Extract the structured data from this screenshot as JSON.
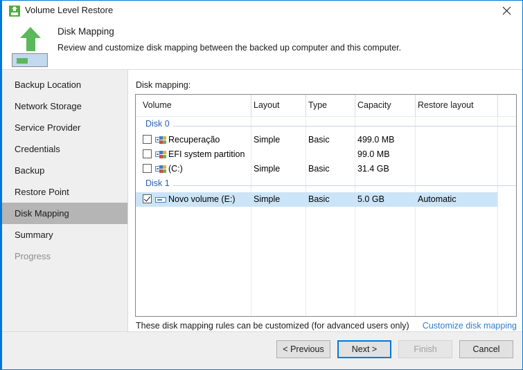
{
  "window": {
    "title": "Volume Level Restore",
    "close_label": "Close",
    "icon": "restore-upload-icon"
  },
  "header": {
    "title": "Disk Mapping",
    "subtitle": "Review and customize disk mapping between the backed up computer and this computer.",
    "icon": "green-up-arrow-volume-icon"
  },
  "sidebar": {
    "items": [
      {
        "label": "Backup Location",
        "state": "normal"
      },
      {
        "label": "Network Storage",
        "state": "normal"
      },
      {
        "label": "Service Provider",
        "state": "normal"
      },
      {
        "label": "Credentials",
        "state": "normal"
      },
      {
        "label": "Backup",
        "state": "normal"
      },
      {
        "label": "Restore Point",
        "state": "normal"
      },
      {
        "label": "Disk Mapping",
        "state": "selected"
      },
      {
        "label": "Summary",
        "state": "normal"
      },
      {
        "label": "Progress",
        "state": "disabled"
      }
    ]
  },
  "main": {
    "grid_label": "Disk mapping:",
    "columns": [
      "Volume",
      "Layout",
      "Type",
      "Capacity",
      "Restore layout"
    ],
    "groups": [
      {
        "label": "Disk 0",
        "rows": [
          {
            "checked": false,
            "icon": "partition-icon",
            "volume": "Recuperação",
            "layout": "Simple",
            "type": "Basic",
            "capacity": "499.0 MB",
            "restore_layout": "",
            "selected": false
          },
          {
            "checked": false,
            "icon": "partition-icon",
            "volume": "EFI system partition",
            "layout": "",
            "type": "",
            "capacity": "99.0 MB",
            "restore_layout": "",
            "selected": false
          },
          {
            "checked": false,
            "icon": "partition-icon",
            "volume": "(C:)",
            "layout": "Simple",
            "type": "Basic",
            "capacity": "31.4 GB",
            "restore_layout": "",
            "selected": false
          }
        ]
      },
      {
        "label": "Disk 1",
        "rows": [
          {
            "checked": true,
            "icon": "drive-icon",
            "volume": "Novo volume (E:)",
            "layout": "Simple",
            "type": "Basic",
            "capacity": "5.0 GB",
            "restore_layout": "Automatic",
            "selected": true
          }
        ]
      }
    ],
    "footer_note": "These disk mapping rules can be customized (for advanced users only)",
    "customize_link": "Customize disk mapping"
  },
  "buttons": {
    "previous": "< Previous",
    "next": "Next >",
    "finish": "Finish",
    "cancel": "Cancel"
  },
  "colors": {
    "accent": "#0078d7",
    "link": "#2e7fd4",
    "group_label": "#2b5cb8",
    "selection": "#cce4f7",
    "sidebar_bg": "#efefef",
    "sidebar_selected": "#b5b5b5",
    "icon_green": "#5cb85c"
  }
}
